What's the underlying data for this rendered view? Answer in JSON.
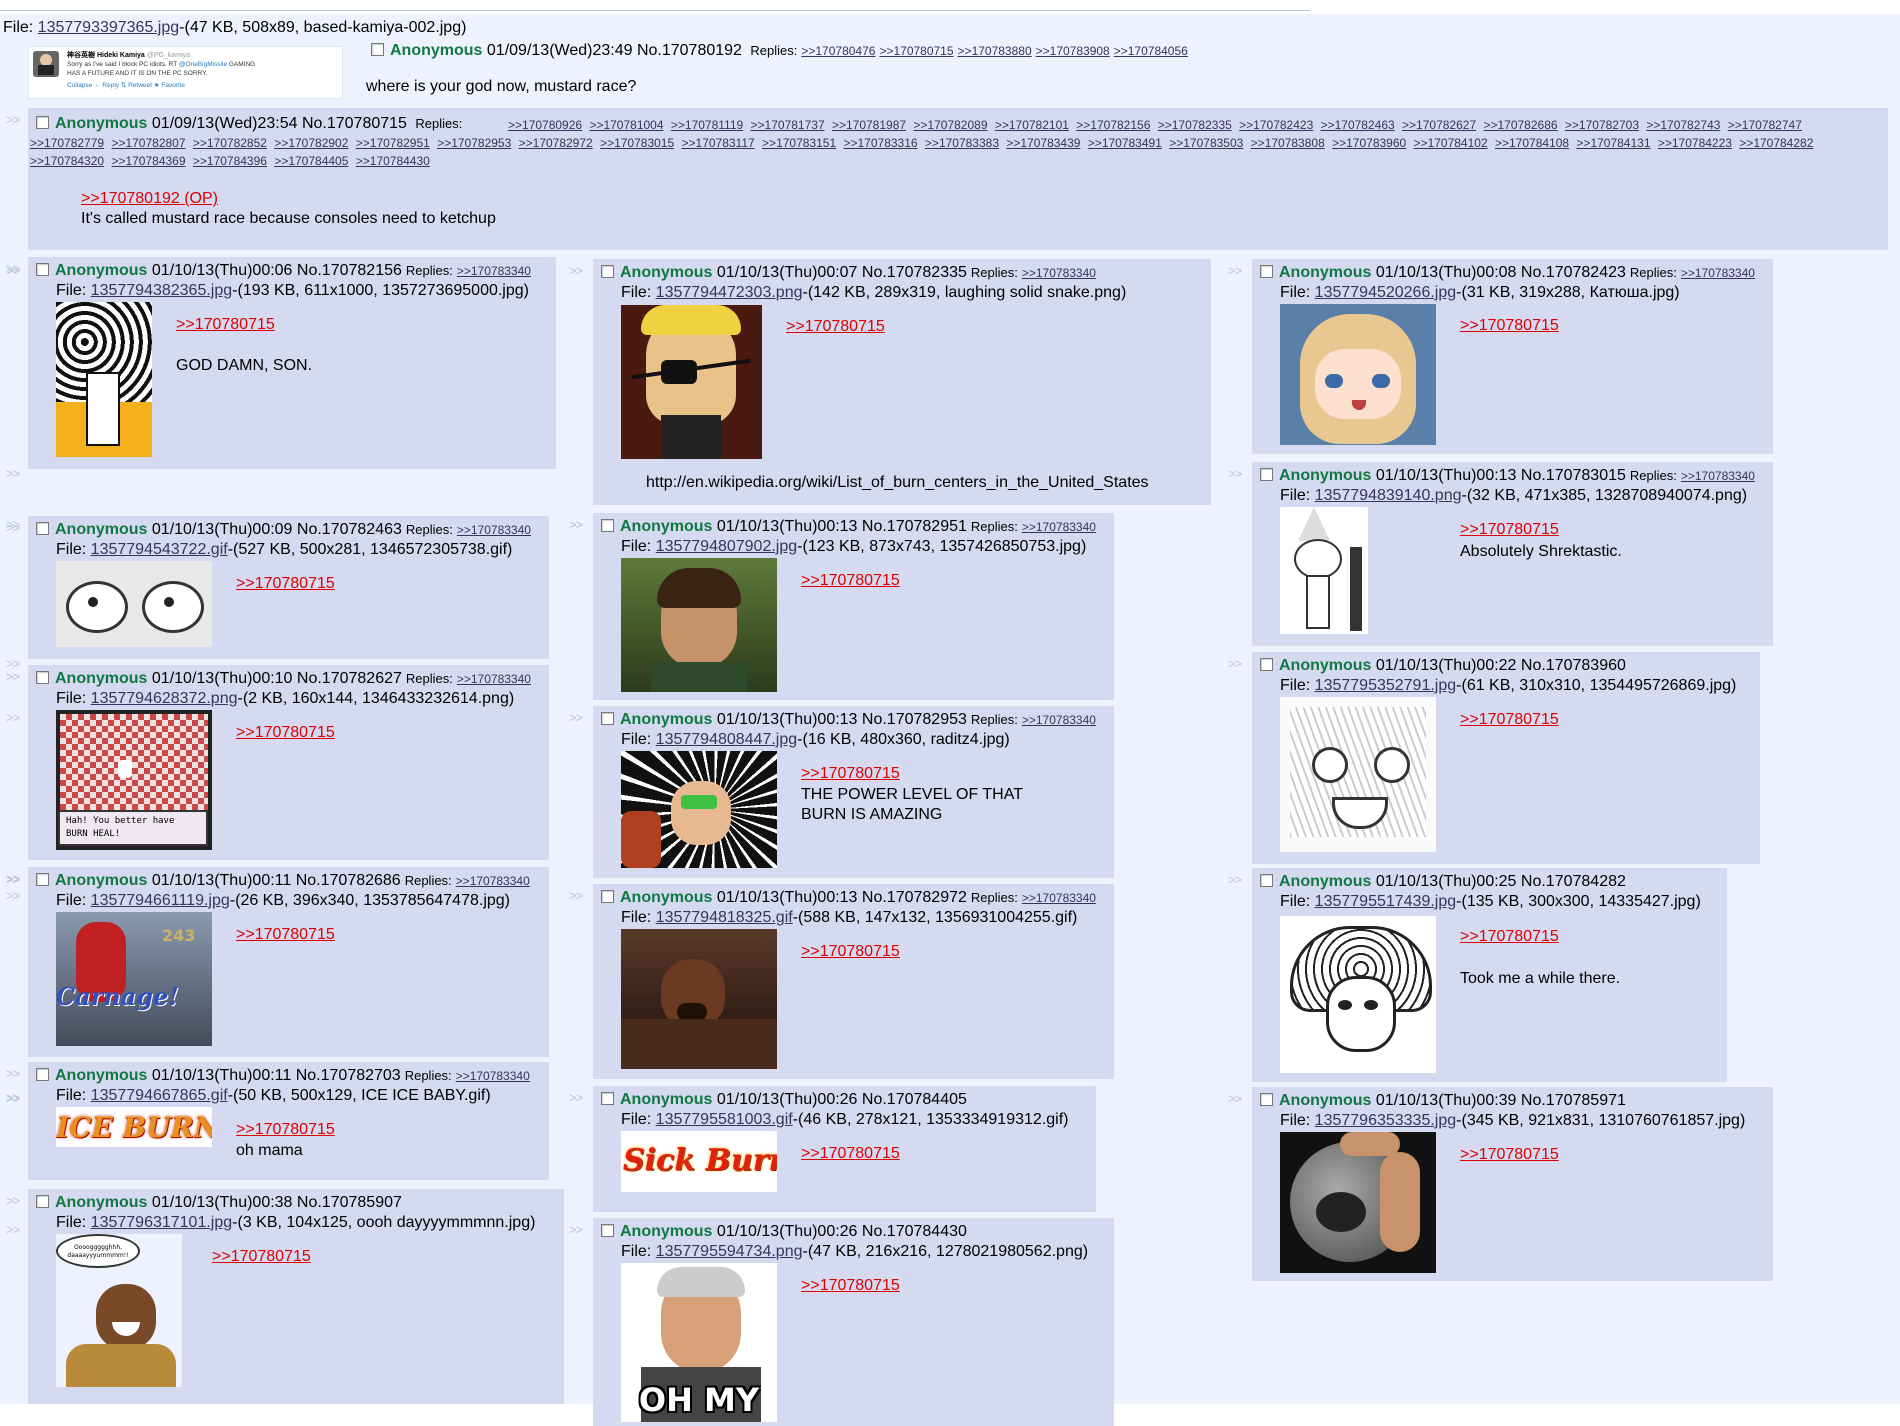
{
  "op": {
    "file_label": "File: ",
    "file_name": "1357793397365.jpg",
    "file_meta": "-(47 KB, 508x89, based-kamiya-002.jpg)",
    "tweet_author": "神谷英樹 Hideki Kamiya",
    "tweet_handle": "@PG_kamiya",
    "tweet_text1": "Sorry as I've said I block PC idiots. RT",
    "tweet_mention": "@OneBigMissile",
    "tweet_text2": "GAMING",
    "tweet_text3": "HAS A FUTURE AND IT IS ON THE PC SORRY.",
    "tweet_actions": "Collapse  ← Reply  ⇅ Retweet  ★ Favorite",
    "name": "Anonymous",
    "datetime": "01/09/13(Wed)23:49",
    "no": "No.170780192",
    "replies_label": "Replies:",
    "replies": [
      ">>170780476",
      ">>170780715",
      ">>170783880",
      ">>170783908",
      ">>170784056"
    ],
    "comment": "where is your god now, mustard race?"
  },
  "reply_main": {
    "arrows": ">>",
    "name": "Anonymous",
    "datetime": "01/09/13(Wed)23:54",
    "no": "No.170780715",
    "replies_label": "Replies:",
    "replies": [
      ">>170780926",
      ">>170781004",
      ">>170781119",
      ">>170781737",
      ">>170781987",
      ">>170782089",
      ">>170782101",
      ">>170782156",
      ">>170782335",
      ">>170782423",
      ">>170782463",
      ">>170782627",
      ">>170782686",
      ">>170782703",
      ">>170782743",
      ">>170782747",
      ">>170782779",
      ">>170782807",
      ">>170782852",
      ">>170782902",
      ">>170782951",
      ">>170782953",
      ">>170782972",
      ">>170783015",
      ">>170783117",
      ">>170783151",
      ">>170783316",
      ">>170783383",
      ">>170783439",
      ">>170783491",
      ">>170783503",
      ">>170783808",
      ">>170783960",
      ">>170784102",
      ">>170784108",
      ">>170784131",
      ">>170784223",
      ">>170784282",
      ">>170784320",
      ">>170784369",
      ">>170784396",
      ">>170784405",
      ">>170784430"
    ],
    "quote": ">>170780192 (OP)",
    "comment": "It's called mustard race because consoles need to ketchup"
  },
  "thread_posts": [
    {
      "name": "Anonymous",
      "datetime": "01/10/13(Thu)00:06",
      "no": "No.170782156",
      "replies_label": "Replies:",
      "reply": ">>170783340",
      "file_label": "File: ",
      "file_name": "1357794382365.jpg",
      "file_meta": "-(193 KB, 611x1000, 1357273695000.jpg)",
      "quote": ">>170780715",
      "comment": "GOD DAMN, SON.",
      "comment2": ""
    },
    {
      "name": "Anonymous",
      "datetime": "01/10/13(Thu)00:07",
      "no": "No.170782335",
      "replies_label": "Replies:",
      "reply": ">>170783340",
      "file_label": "File: ",
      "file_name": "1357794472303.png",
      "file_meta": "-(142 KB, 289x319, laughing solid snake.png)",
      "quote": ">>170780715",
      "comment": "http://en.wikipedia.org/wiki/List_of_burn_centers_in_the_United_States",
      "comment2": ""
    },
    {
      "name": "Anonymous",
      "datetime": "01/10/13(Thu)00:08",
      "no": "No.170782423",
      "replies_label": "Replies:",
      "reply": ">>170783340",
      "file_label": "File: ",
      "file_name": "1357794520266.jpg",
      "file_meta": "-(31 KB, 319x288, Катюша.jpg)",
      "quote": ">>170780715",
      "comment": "",
      "comment2": ""
    },
    {
      "name": "Anonymous",
      "datetime": "01/10/13(Thu)00:09",
      "no": "No.170782463",
      "replies_label": "Replies:",
      "reply": ">>170783340",
      "file_label": "File: ",
      "file_name": "1357794543722.gif",
      "file_meta": "-(527 KB, 500x281, 1346572305738.gif)",
      "quote": ">>170780715",
      "comment": "",
      "comment2": ""
    },
    {
      "name": "Anonymous",
      "datetime": "01/10/13(Thu)00:13",
      "no": "No.170782951",
      "replies_label": "Replies:",
      "reply": ">>170783340",
      "file_label": "File: ",
      "file_name": "1357794807902.jpg",
      "file_meta": "-(123 KB, 873x743, 1357426850753.jpg)",
      "quote": ">>170780715",
      "comment": "",
      "comment2": ""
    },
    {
      "name": "Anonymous",
      "datetime": "01/10/13(Thu)00:13",
      "no": "No.170783015",
      "replies_label": "Replies:",
      "reply": ">>170783340",
      "file_label": "File: ",
      "file_name": "1357794839140.png",
      "file_meta": "-(32 KB, 471x385, 1328708940074.png)",
      "quote": ">>170780715",
      "comment": "Absolutely Shrektastic.",
      "comment2": ""
    },
    {
      "name": "Anonymous",
      "datetime": "01/10/13(Thu)00:10",
      "no": "No.170782627",
      "replies_label": "Replies:",
      "reply": ">>170783340",
      "file_label": "File: ",
      "file_name": "1357794628372.png",
      "file_meta": "-(2 KB, 160x144, 1346433232614.png)",
      "quote": ">>170780715",
      "comment": "",
      "comment2": "",
      "thumb_text": "Hah! You better have BURN HEAL!"
    },
    {
      "name": "Anonymous",
      "datetime": "01/10/13(Thu)00:13",
      "no": "No.170782953",
      "replies_label": "Replies:",
      "reply": ">>170783340",
      "file_label": "File: ",
      "file_name": "1357794808447.jpg",
      "file_meta": "-(16 KB, 480x360, raditz4.jpg)",
      "quote": ">>170780715",
      "comment": "THE POWER LEVEL OF THAT",
      "comment2": "BURN IS AMAZING"
    },
    {
      "name": "Anonymous",
      "datetime": "01/10/13(Thu)00:22",
      "no": "No.170783960",
      "replies_label": "",
      "reply": "",
      "file_label": "File: ",
      "file_name": "1357795352791.jpg",
      "file_meta": "-(61 KB, 310x310, 1354495726869.jpg)",
      "quote": ">>170780715",
      "comment": "",
      "comment2": ""
    },
    {
      "name": "Anonymous",
      "datetime": "01/10/13(Thu)00:11",
      "no": "No.170782686",
      "replies_label": "Replies:",
      "reply": ">>170783340",
      "file_label": "File: ",
      "file_name": "1357794661119.jpg",
      "file_meta": "-(26 KB, 396x340, 1353785647478.jpg)",
      "quote": ">>170780715",
      "comment": "",
      "comment2": "",
      "thumb_text": "Carnage!",
      "thumb_num": "243"
    },
    {
      "name": "Anonymous",
      "datetime": "01/10/13(Thu)00:13",
      "no": "No.170782972",
      "replies_label": "Replies:",
      "reply": ">>170783340",
      "file_label": "File: ",
      "file_name": "1357794818325.gif",
      "file_meta": "-(588 KB, 147x132, 1356931004255.gif)",
      "quote": ">>170780715",
      "comment": "",
      "comment2": ""
    },
    {
      "name": "Anonymous",
      "datetime": "01/10/13(Thu)00:25",
      "no": "No.170784282",
      "replies_label": "",
      "reply": "",
      "file_label": "File: ",
      "file_name": "1357795517439.jpg",
      "file_meta": "-(135 KB, 300x300, 14335427.jpg)",
      "quote": ">>170780715",
      "comment": "Took me a while there.",
      "comment2": ""
    },
    {
      "name": "Anonymous",
      "datetime": "01/10/13(Thu)00:11",
      "no": "No.170782703",
      "replies_label": "Replies:",
      "reply": ">>170783340",
      "file_label": "File: ",
      "file_name": "1357794667865.gif",
      "file_meta": "-(50 KB, 500x129, ICE ICE BABY.gif)",
      "quote": ">>170780715",
      "comment": "oh mama",
      "comment2": "",
      "thumb_text": "ICE BURN"
    },
    {
      "name": "Anonymous",
      "datetime": "01/10/13(Thu)00:26",
      "no": "No.170784405",
      "replies_label": "",
      "reply": "",
      "file_label": "File: ",
      "file_name": "1357795581003.gif",
      "file_meta": "-(46 KB, 278x121, 1353334919312.gif)",
      "quote": ">>170780715",
      "comment": "",
      "comment2": "",
      "thumb_text": "Sick Burn"
    },
    {
      "name": "Anonymous",
      "datetime": "01/10/13(Thu)00:39",
      "no": "No.170785971",
      "replies_label": "",
      "reply": "",
      "file_label": "File: ",
      "file_name": "1357796353335.jpg",
      "file_meta": "-(345 KB, 921x831, 1310760761857.jpg)",
      "quote": ">>170780715",
      "comment": "",
      "comment2": ""
    },
    {
      "name": "Anonymous",
      "datetime": "01/10/13(Thu)00:38",
      "no": "No.170785907",
      "replies_label": "",
      "reply": "",
      "file_label": "File: ",
      "file_name": "1357796317101.jpg",
      "file_meta": "-(3 KB, 104x125, oooh dayyyymmmnn.jpg)",
      "quote": ">>170780715",
      "comment": "",
      "comment2": "",
      "thumb_text": "Ooooggggghhh, daaaayyyummmm!!"
    },
    {
      "name": "Anonymous",
      "datetime": "01/10/13(Thu)00:26",
      "no": "No.170784430",
      "replies_label": "",
      "reply": "",
      "file_label": "File: ",
      "file_name": "1357795594734.png",
      "file_meta": "-(47 KB, 216x216, 1278021980562.png)",
      "quote": ">>170780715",
      "comment": "",
      "comment2": "",
      "thumb_text": "OH MY"
    }
  ],
  "arrows": ">>",
  "colors": {
    "post_bg": "#d6daf0",
    "page_bg": "#eef2ff",
    "name": "#117743",
    "quote": "#dd0000",
    "link": "#34345c"
  }
}
